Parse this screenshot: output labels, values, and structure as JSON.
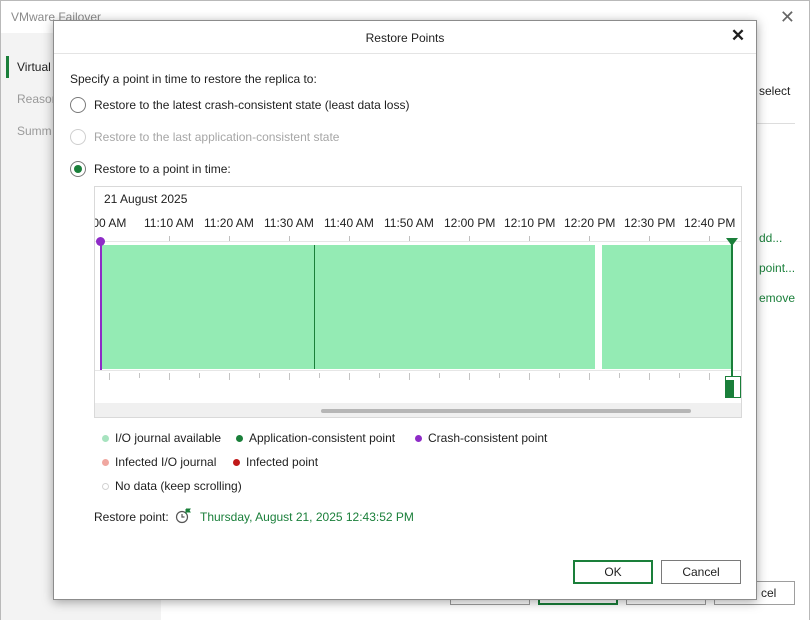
{
  "background": {
    "title": "VMware Failover",
    "nav": [
      "Virtual",
      "Reason",
      "Summ"
    ],
    "right_texts": [
      "select",
      "dd...",
      "point...",
      "emove"
    ],
    "cancel_label": "cel"
  },
  "dialog": {
    "title": "Restore Points",
    "close_icon": "close-icon",
    "prompt": "Specify a point in time to restore the replica to:",
    "options": [
      {
        "label": "Restore to the latest crash-consistent state (least data loss)",
        "checked": false,
        "enabled": true
      },
      {
        "label": "Restore to the last application-consistent state",
        "checked": false,
        "enabled": false
      },
      {
        "label": "Restore to a point in time:",
        "checked": true,
        "enabled": true
      }
    ],
    "timeline": {
      "date": "21 August 2025",
      "time_labels": [
        ":00 AM",
        "11:10 AM",
        "11:20 AM",
        "11:30 AM",
        "11:40 AM",
        "11:50 AM",
        "12:00 PM",
        "12:10 PM",
        "12:20 PM",
        "12:30 PM",
        "12:40 PM"
      ]
    },
    "legend": [
      {
        "label": "I/O journal available",
        "color": "#a7e3bf"
      },
      {
        "label": "Application-consistent point",
        "color": "#1a7f3a"
      },
      {
        "label": "Crash-consistent point",
        "color": "#8e2bc7"
      },
      {
        "label": "Infected I/O journal",
        "color": "#f0a7a0"
      },
      {
        "label": "Infected point",
        "color": "#c01818"
      },
      {
        "label": "No data (keep scrolling)",
        "color": "#ffffff"
      }
    ],
    "restore_point_label": "Restore point:",
    "restore_point_value": "Thursday, August 21, 2025 12:43:52 PM",
    "ok_label": "OK",
    "cancel_label": "Cancel"
  },
  "colors": {
    "accent": "#1a7f3a",
    "journal_fill": "#94ebb4",
    "crash_point": "#8e2bc7"
  }
}
